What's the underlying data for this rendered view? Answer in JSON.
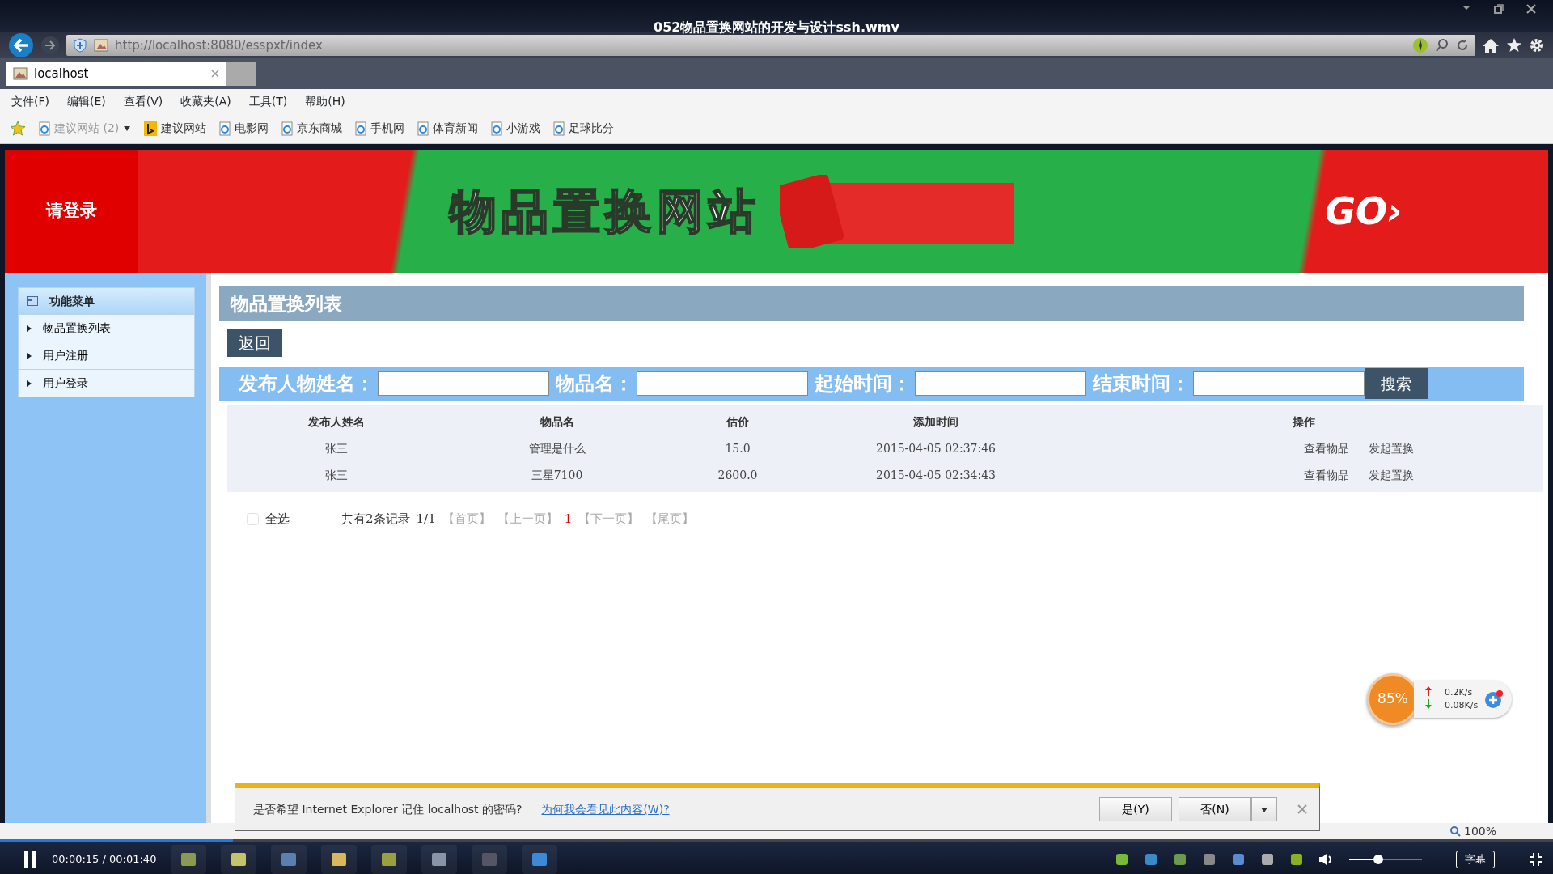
{
  "video_title": "052物品置换网站的开发与设计ssh.wmv",
  "browser": {
    "address": "http://localhost:8080/esspxt/index",
    "tabs": [
      {
        "label": "localhost",
        "selected": true
      }
    ],
    "menu": [
      "文件(F)",
      "编辑(E)",
      "查看(V)",
      "收藏夹(A)",
      "工具(T)",
      "帮助(H)"
    ],
    "favorites": [
      {
        "label": "建议网站 (2)",
        "kind": "dropdown"
      },
      {
        "label": "建议网站",
        "kind": "bing"
      },
      {
        "label": "电影网",
        "kind": "page"
      },
      {
        "label": "京东商城",
        "kind": "page"
      },
      {
        "label": "手机网",
        "kind": "page"
      },
      {
        "label": "体育新闻",
        "kind": "page"
      },
      {
        "label": "小游戏",
        "kind": "page"
      },
      {
        "label": "足球比分",
        "kind": "page"
      }
    ]
  },
  "banner": {
    "login": "请登录",
    "title": "物品置换网站",
    "go": "GO›"
  },
  "sidebar": {
    "header": "功能菜单",
    "items": [
      "物品置换列表",
      "用户注册",
      "用户登录"
    ]
  },
  "main": {
    "title": "物品置换列表",
    "back_button": "返回",
    "search": {
      "fields": [
        {
          "label": "发布人物姓名："
        },
        {
          "label": "物品名："
        },
        {
          "label": "起始时间："
        },
        {
          "label": "结束时间："
        }
      ],
      "button": "搜索"
    },
    "table": {
      "columns": [
        "发布人姓名",
        "物品名",
        "估价",
        "添加时间",
        "操作"
      ],
      "rows": [
        {
          "name": "张三",
          "item": "管理是什么",
          "price": "15.0",
          "time": "2015-04-05 02:37:46",
          "actions": [
            "查看物品",
            "发起置换"
          ]
        },
        {
          "name": "张三",
          "item": "三星7100",
          "price": "2600.0",
          "time": "2015-04-05 02:34:43",
          "actions": [
            "查看物品",
            "发起置换"
          ]
        }
      ]
    },
    "footer": {
      "select_all": {
        "label": "全选",
        "checked": false
      },
      "summary": "共有2条记录",
      "page": "1/1",
      "pager": [
        {
          "label": "【首页】",
          "current": false
        },
        {
          "label": "【上一页】",
          "current": false
        },
        {
          "label": "1",
          "current": true
        },
        {
          "label": "【下一页】",
          "current": false
        },
        {
          "label": "【尾页】",
          "current": false
        }
      ]
    }
  },
  "notification": {
    "message": "是否希望 Internet Explorer 记住 localhost 的密码?",
    "link": "为何我会看见此内容(W)?",
    "buttons": [
      "是(Y)",
      "否(N)"
    ]
  },
  "network_widget": {
    "percent": "85%",
    "upload": "0.2K/s",
    "download": "0.08K/s"
  },
  "status_bar": {
    "zoom": "100%"
  },
  "player": {
    "time": "00:00:15 / 00:01:40",
    "progress": {
      "level": 0.15
    },
    "volume": {
      "level": 0.4
    },
    "subtitle_button": "字幕"
  }
}
